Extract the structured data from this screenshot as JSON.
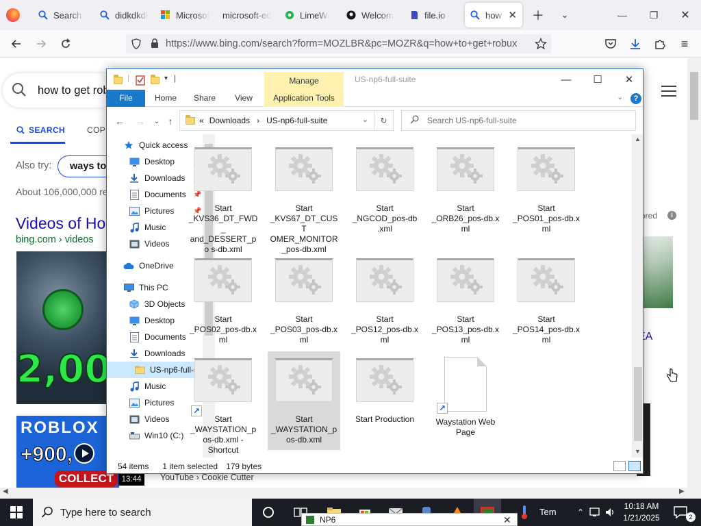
{
  "browser": {
    "tabs": [
      {
        "label": "Search -",
        "icon": "magnifier-icon",
        "active": false
      },
      {
        "label": "didkdkdk",
        "icon": "magnifier-icon",
        "active": false
      },
      {
        "label": "Microsof",
        "icon": "microsoft-edge-icon",
        "active": false
      },
      {
        "label": "microsoft-ed",
        "icon": "none",
        "active": false
      },
      {
        "label": "LimeWi",
        "icon": "limewire-icon",
        "active": false
      },
      {
        "label": "Welcom",
        "icon": "github-icon",
        "active": false
      },
      {
        "label": "file.io -",
        "icon": "file-io-icon",
        "active": false
      },
      {
        "label": "how t",
        "icon": "magnifier-icon",
        "active": true
      }
    ],
    "url": "https://www.bing.com/search?form=MOZLBR&pc=MOZR&q=how+to+get+robux"
  },
  "bing": {
    "query": "how to get rob",
    "tab_search": "SEARCH",
    "tab_copilot": "COPIL",
    "also_try_label": "Also try:",
    "also_try_chip": "ways to",
    "about_results": "About 106,000,000 re",
    "videos_title": "Videos of Ho",
    "videos_source": "bing.com › videos",
    "thumb_big_text": "2,000",
    "thumb2_brand": "ROBLOX",
    "thumb2_count": "+900,",
    "thumb2_collect": "COLLECT",
    "duration": "13:44",
    "yt_source": "YouTube › Cookie Cutter",
    "sponsored": "sored",
    "right_fragment": "EA"
  },
  "explorer": {
    "window_title": "US-np6-full-suite",
    "manage_tab": "Manage",
    "ribbon_tabs": {
      "file": "File",
      "home": "Home",
      "share": "Share",
      "view": "View",
      "app_tools": "Application Tools"
    },
    "breadcrumb": {
      "chevron": "«",
      "part1": "Downloads",
      "sep": "›",
      "part2": "US-np6-full-suite"
    },
    "search_placeholder": "Search US-np6-full-suite",
    "nav": [
      {
        "label": "Quick access",
        "icon": "star-icon",
        "pinned": false
      },
      {
        "label": "Desktop",
        "icon": "desktop-icon",
        "pinned": true
      },
      {
        "label": "Downloads",
        "icon": "download-icon",
        "pinned": true
      },
      {
        "label": "Documents",
        "icon": "documents-icon",
        "pinned": true
      },
      {
        "label": "Pictures",
        "icon": "pictures-icon",
        "pinned": true
      },
      {
        "label": "Music",
        "icon": "music-icon",
        "pinned": false
      },
      {
        "label": "Videos",
        "icon": "videos-icon",
        "pinned": false
      },
      {
        "label": "OneDrive",
        "icon": "cloud-icon",
        "pinned": false
      },
      {
        "label": "This PC",
        "icon": "computer-icon",
        "pinned": false
      },
      {
        "label": "3D Objects",
        "icon": "cube-icon",
        "pinned": false
      },
      {
        "label": "Desktop",
        "icon": "desktop-icon",
        "pinned": false
      },
      {
        "label": "Documents",
        "icon": "documents-icon",
        "pinned": false
      },
      {
        "label": "Downloads",
        "icon": "download-icon",
        "pinned": false
      },
      {
        "label": "US-np6-full-su",
        "icon": "folder-icon",
        "pinned": false
      },
      {
        "label": "Music",
        "icon": "music-icon",
        "pinned": false
      },
      {
        "label": "Pictures",
        "icon": "pictures-icon",
        "pinned": false
      },
      {
        "label": "Videos",
        "icon": "videos-icon",
        "pinned": false
      },
      {
        "label": "Win10 (C:)",
        "icon": "drive-icon",
        "pinned": false
      }
    ],
    "files": [
      {
        "label": "Start _KVS36_DT_FWD_ and_DESSERT_po s-db.xml",
        "type": "settings",
        "shortcut": false,
        "selected": false
      },
      {
        "label": "Start _KVS67_DT_CUST OMER_MONITOR _pos-db.xml",
        "type": "settings",
        "shortcut": false,
        "selected": false
      },
      {
        "label": "Start _NGCOD_pos-db .xml",
        "type": "settings",
        "shortcut": false,
        "selected": false
      },
      {
        "label": "Start _ORB26_pos-db.x ml",
        "type": "settings",
        "shortcut": false,
        "selected": false
      },
      {
        "label": "Start _POS01_pos-db.x ml",
        "type": "settings",
        "shortcut": false,
        "selected": false
      },
      {
        "label": "Start _POS02_pos-db.x ml",
        "type": "settings",
        "shortcut": false,
        "selected": false
      },
      {
        "label": "Start _POS03_pos-db.x ml",
        "type": "settings",
        "shortcut": false,
        "selected": false
      },
      {
        "label": "Start _POS12_pos-db.x ml",
        "type": "settings",
        "shortcut": false,
        "selected": false
      },
      {
        "label": "Start _POS13_pos-db.x ml",
        "type": "settings",
        "shortcut": false,
        "selected": false
      },
      {
        "label": "Start _POS14_pos-db.x ml",
        "type": "settings",
        "shortcut": false,
        "selected": false
      },
      {
        "label": "Start _WAYSTATION_p os-db.xml - Shortcut",
        "type": "settings",
        "shortcut": true,
        "selected": false
      },
      {
        "label": "Start _WAYSTATION_p os-db.xml",
        "type": "settings",
        "shortcut": false,
        "selected": true
      },
      {
        "label": "Start Production",
        "type": "settings",
        "shortcut": false,
        "selected": false
      },
      {
        "label": "Waystation Web Page",
        "type": "document",
        "shortcut": true,
        "selected": false
      }
    ],
    "status": {
      "items": "54 items",
      "selected": "1 item selected",
      "size": "179 bytes"
    }
  },
  "taskbar": {
    "search_placeholder": "Type here to search",
    "weather": "Tem",
    "time": "10:18 AM",
    "date": "1/21/2025",
    "notifications": "2",
    "tooltip": "NP6"
  },
  "colors": {
    "accent": "#1979ca",
    "manage": "#fff2b0",
    "bing_blue": "#174ae4",
    "link": "#1a0dab",
    "taskbar": "#1b1d24"
  }
}
